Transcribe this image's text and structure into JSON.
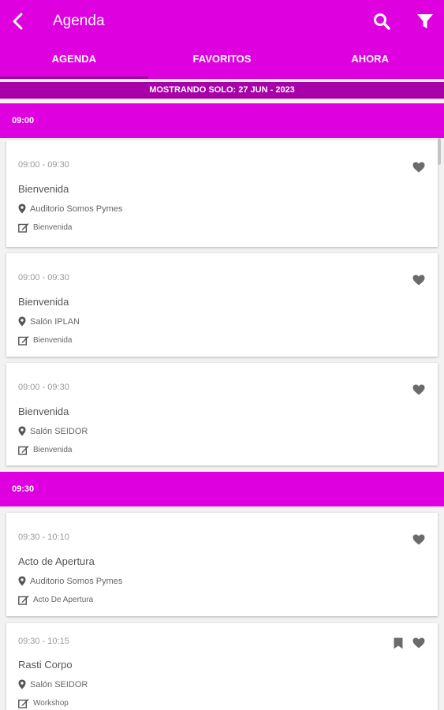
{
  "header": {
    "title": "Agenda"
  },
  "tabs": [
    {
      "label": "AGENDA"
    },
    {
      "label": "FAVORITOS"
    },
    {
      "label": "AHORA"
    }
  ],
  "date_banner": "MOSTRANDO SOLO: 27 JUN - 2023",
  "slots": [
    {
      "label": "09:00"
    },
    {
      "label": "09:30"
    }
  ],
  "sessions": [
    {
      "time": "09:00 - 09:30",
      "name": "Bienvenida",
      "location": "Auditorio Somos Pymes",
      "type": "Bienvenida"
    },
    {
      "time": "09:00 - 09:30",
      "name": "Bienvenida",
      "location": "Salón IPLAN",
      "type": "Bienvenida"
    },
    {
      "time": "09:00 - 09:30",
      "name": "Bienvenida",
      "location": "Salón SEIDOR",
      "type": "Bienvenida"
    },
    {
      "time": "09:30 - 10:10",
      "name": "Acto de Apertura",
      "location": "Auditorio Somos Pymes",
      "type": "Acto De Apertura"
    },
    {
      "time": "09:30 - 10:15",
      "name": "Rasti Corpo",
      "location": "Salón SEIDOR",
      "type": "Workshop"
    }
  ],
  "colors": {
    "primary": "#df00df",
    "banner": "#a800a8",
    "icon": "#6b6b6b"
  }
}
